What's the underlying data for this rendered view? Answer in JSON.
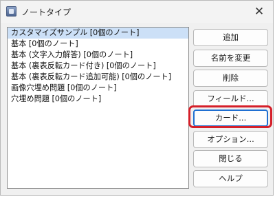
{
  "window": {
    "title": "ノートタイプ",
    "close_glyph": "✕",
    "icon": "app-icon"
  },
  "note_types": [
    "カスタマイズサンプル [0個のノート]",
    "基本 [0個のノート]",
    "基本 (文字入力解答) [0個のノート]",
    "基本 (裏表反転カード付き) [0個のノート]",
    "基本 (裏表反転カード追加可能) [0個のノート]",
    "画像穴埋め問題 [0個のノート]",
    "穴埋め問題 [0個のノート]"
  ],
  "selected_index": 0,
  "buttons": {
    "add": "追加",
    "rename": "名前を変更",
    "delete": "削除",
    "fields": "フィールド...",
    "cards": "カード...",
    "options": "オプション...",
    "close": "閉じる",
    "help": "ヘルプ"
  },
  "highlight": {
    "color": "#d51f29",
    "target": "cards"
  }
}
